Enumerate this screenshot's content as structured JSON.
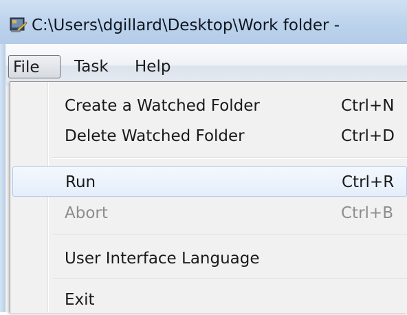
{
  "window": {
    "title": "C:\\Users\\dgillard\\Desktop\\Work folder -",
    "icon": "app-icon"
  },
  "menubar": {
    "items": [
      {
        "label": "File",
        "active": true
      },
      {
        "label": "Task",
        "active": false
      },
      {
        "label": "Help",
        "active": false
      }
    ]
  },
  "file_menu": {
    "items": [
      {
        "label": "Create a Watched Folder",
        "shortcut": "Ctrl+N",
        "enabled": true
      },
      {
        "label": "Delete Watched Folder",
        "shortcut": "Ctrl+D",
        "enabled": true
      },
      {
        "label": "Run",
        "shortcut": "Ctrl+R",
        "enabled": true,
        "highlighted": true
      },
      {
        "label": "Abort",
        "shortcut": "Ctrl+B",
        "enabled": false
      },
      {
        "label": "User Interface Language",
        "shortcut": "",
        "enabled": true
      },
      {
        "label": "Exit",
        "shortcut": "",
        "enabled": true
      }
    ]
  },
  "colors": {
    "titlebar": "#bcd3ec",
    "menu_background": "#f1f1f1",
    "highlight_border": "#aecbef",
    "disabled_text": "#8d8d8d"
  }
}
